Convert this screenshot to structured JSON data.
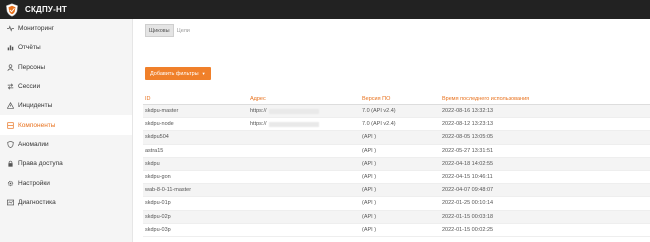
{
  "app": {
    "title": "СКДПУ-НТ"
  },
  "sidebar": {
    "items": [
      {
        "label": "Мониторинг",
        "icon": "pulse-icon"
      },
      {
        "label": "Отчёты",
        "icon": "chart-icon"
      },
      {
        "label": "Персоны",
        "icon": "user-icon"
      },
      {
        "label": "Сессии",
        "icon": "arrows-icon"
      },
      {
        "label": "Инциденты",
        "icon": "warning-icon"
      },
      {
        "label": "Компоненты",
        "icon": "components-icon",
        "active": true
      },
      {
        "label": "Аномалии",
        "icon": "shield-icon"
      },
      {
        "label": "Права доступа",
        "icon": "lock-icon"
      },
      {
        "label": "Настройки",
        "icon": "gear-icon"
      },
      {
        "label": "Диагностика",
        "icon": "diagnostics-icon"
      }
    ]
  },
  "tabs": [
    "Щиковы",
    "Цели"
  ],
  "add_filter_label": "Добавить фильтры",
  "table": {
    "headers": [
      "ID",
      "Адрес",
      "Версия ПО",
      "Время последнего использования"
    ],
    "rows": [
      {
        "id": "skdpu-master",
        "address": "https://",
        "version": "7.0 (API v2.4)",
        "last_used": "2022-08-16 13:32:13"
      },
      {
        "id": "skdpu-node",
        "address": "https://",
        "version": "7.0 (API v2.4)",
        "last_used": "2022-08-12 13:23:13"
      },
      {
        "id": "skdpu504",
        "address": "",
        "version": "(API )",
        "last_used": "2022-08-05 13:05:05"
      },
      {
        "id": "astra15",
        "address": "",
        "version": "(API )",
        "last_used": "2022-05-27 13:31:51"
      },
      {
        "id": "skdpu",
        "address": "",
        "version": "(API )",
        "last_used": "2022-04-18 14:02:55"
      },
      {
        "id": "skdpu-gon",
        "address": "",
        "version": "(API )",
        "last_used": "2022-04-15 10:46:11"
      },
      {
        "id": "wab-8-0-11-master",
        "address": "",
        "version": "(API )",
        "last_used": "2022-04-07 09:48:07"
      },
      {
        "id": "skdpu-01p",
        "address": "",
        "version": "(API )",
        "last_used": "2022-01-25 00:10:14"
      },
      {
        "id": "skdpu-02p",
        "address": "",
        "version": "(API )",
        "last_used": "2022-01-15 00:03:18"
      },
      {
        "id": "skdpu-03p",
        "address": "",
        "version": "(API )",
        "last_used": "2022-01-15 00:02:25"
      }
    ]
  },
  "colors": {
    "accent": "#e8711c",
    "button": "#f0802a",
    "topbar": "#222222"
  }
}
